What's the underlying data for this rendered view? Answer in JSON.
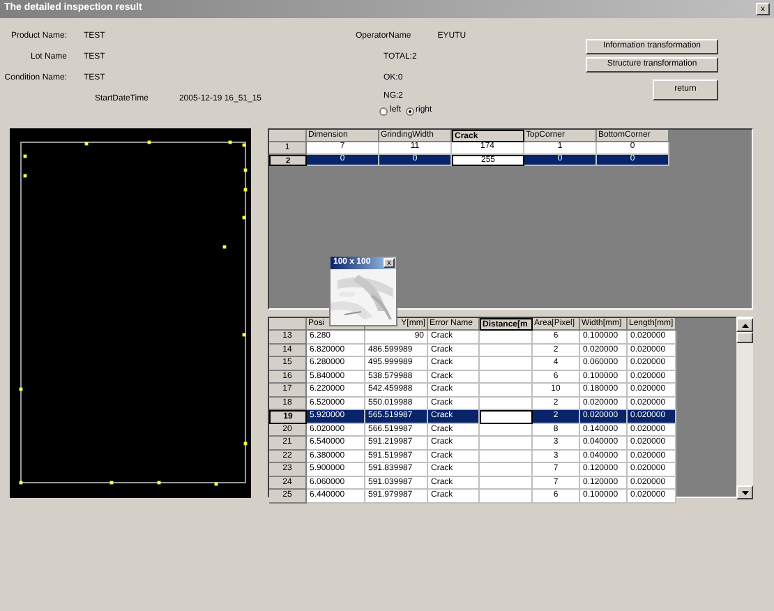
{
  "window": {
    "title": "The detailed inspection result",
    "close": "x"
  },
  "info": [
    {
      "label": "Product Name:",
      "value": "TEST"
    },
    {
      "label": "Lot Name",
      "value": "TEST"
    },
    {
      "label": "Condition Name:",
      "value": "TEST"
    }
  ],
  "start_date_time": {
    "label": "StartDateTime",
    "value": "2005-12-19 16_51_15"
  },
  "operator": {
    "label": "OperatorName",
    "value": "EYUTU"
  },
  "totals": [
    "TOTAL:2",
    "OK:0",
    "NG:2"
  ],
  "side": [
    {
      "label": "left",
      "selected": false
    },
    {
      "label": "right",
      "selected": true
    }
  ],
  "buttons": [
    "Information transformation",
    "Structure transformation",
    "return"
  ],
  "summary_grid": {
    "columns": [
      {
        "label": "Dimension",
        "current": false
      },
      {
        "label": "GrindingWidth",
        "current": false
      },
      {
        "label": "Crack",
        "current": true
      },
      {
        "label": "TopCorner",
        "current": false
      },
      {
        "label": "BottomCorner",
        "current": false
      }
    ],
    "rows": [
      {
        "number": "1",
        "selected": false,
        "cells": [
          "7",
          "11",
          "174",
          "1",
          "0"
        ]
      },
      {
        "number": "2",
        "selected": true,
        "cells": [
          "0",
          "0",
          "255",
          "0",
          "0"
        ]
      }
    ]
  },
  "popup": {
    "title": "100 x 100",
    "close": "x"
  },
  "defect_grid": {
    "columns": [
      {
        "label": "Posi",
        "current": false,
        "kind": "text"
      },
      {
        "label": "Y[mm]",
        "current": false,
        "kind": "text"
      },
      {
        "label": "Error Name",
        "current": false,
        "kind": "text"
      },
      {
        "label": "Distance[m",
        "current": true,
        "kind": "text"
      },
      {
        "label": "Area[Pixel]",
        "current": false,
        "kind": "number"
      },
      {
        "label": "Width[mm]",
        "current": false,
        "kind": "text"
      },
      {
        "label": "Length[mm]",
        "current": false,
        "kind": "text"
      }
    ],
    "rows": [
      {
        "number": "13",
        "selected": false,
        "cells": [
          "6.280",
          "90",
          "Crack",
          "",
          "6",
          "0.100000",
          "0.020000"
        ]
      },
      {
        "number": "14",
        "selected": false,
        "cells": [
          "6.820000",
          "486.599989",
          "Crack",
          "",
          "2",
          "0.020000",
          "0.020000"
        ]
      },
      {
        "number": "15",
        "selected": false,
        "cells": [
          "6.280000",
          "495.999989",
          "Crack",
          "",
          "4",
          "0.060000",
          "0.020000"
        ]
      },
      {
        "number": "16",
        "selected": false,
        "cells": [
          "5.840000",
          "538.579988",
          "Crack",
          "",
          "6",
          "0.100000",
          "0.020000"
        ]
      },
      {
        "number": "17",
        "selected": false,
        "cells": [
          "6.220000",
          "542.459988",
          "Crack",
          "",
          "10",
          "0.180000",
          "0.020000"
        ]
      },
      {
        "number": "18",
        "selected": false,
        "cells": [
          "6.520000",
          "550.019988",
          "Crack",
          "",
          "2",
          "0.020000",
          "0.020000"
        ]
      },
      {
        "number": "19",
        "selected": true,
        "cells": [
          "5.920000",
          "565.519987",
          "Crack",
          "",
          "2",
          "0.020000",
          "0.020000"
        ]
      },
      {
        "number": "20",
        "selected": false,
        "cells": [
          "6.020000",
          "566.519987",
          "Crack",
          "",
          "8",
          "0.140000",
          "0.020000"
        ]
      },
      {
        "number": "21",
        "selected": false,
        "cells": [
          "6.540000",
          "591.219987",
          "Crack",
          "",
          "3",
          "0.040000",
          "0.020000"
        ]
      },
      {
        "number": "22",
        "selected": false,
        "cells": [
          "6.380000",
          "591.519987",
          "Crack",
          "",
          "3",
          "0.040000",
          "0.020000"
        ]
      },
      {
        "number": "23",
        "selected": false,
        "cells": [
          "5.900000",
          "591.839987",
          "Crack",
          "",
          "7",
          "0.120000",
          "0.020000"
        ]
      },
      {
        "number": "24",
        "selected": false,
        "cells": [
          "6.060000",
          "591.039987",
          "Crack",
          "",
          "7",
          "0.120000",
          "0.020000"
        ]
      },
      {
        "number": "25",
        "selected": false,
        "cells": [
          "6.440000",
          "591.979987",
          "Crack",
          "",
          "6",
          "0.100000",
          "0.020000"
        ]
      }
    ]
  }
}
